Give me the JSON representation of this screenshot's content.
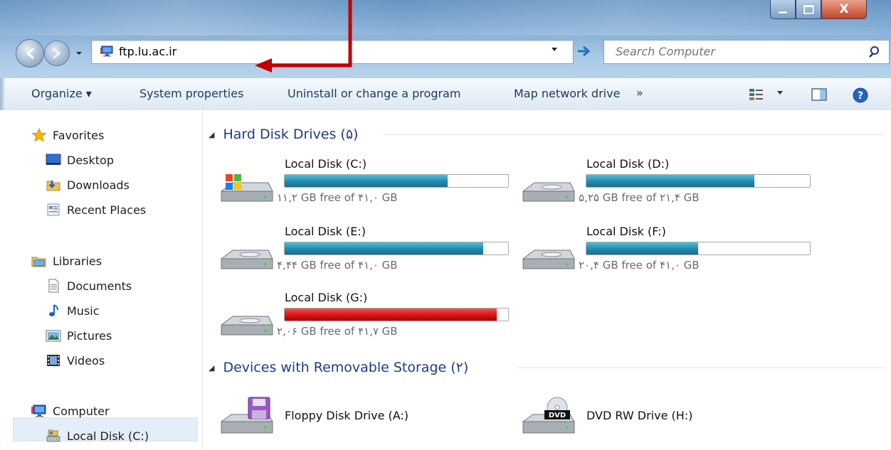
{
  "window": {
    "address": "ftp.lu.ac.ir",
    "search_placeholder": "Search Computer",
    "close_glyph": "X"
  },
  "toolbar": {
    "organize": "Organize ▾",
    "system_properties": "System properties",
    "uninstall": "Uninstall or change a program",
    "map_network_drive": "Map network drive",
    "more": "»"
  },
  "sidebar": {
    "favorites": {
      "label": "Favorites",
      "items": [
        "Desktop",
        "Downloads",
        "Recent Places"
      ]
    },
    "libraries": {
      "label": "Libraries",
      "items": [
        "Documents",
        "Music",
        "Pictures",
        "Videos"
      ]
    },
    "computer": {
      "label": "Computer",
      "items": [
        "Local Disk (C:)"
      ]
    }
  },
  "main": {
    "hard_disk_header": "Hard Disk Drives (۵)",
    "drives": [
      {
        "name": "Local Disk (C:)",
        "free_text": "۱۱,۲ GB free of ۴۱,۰ GB",
        "used_fraction": 0.73,
        "color": "#2389ae"
      },
      {
        "name": "Local Disk (D:)",
        "free_text": "۵,۲۵ GB free of ۲۱,۴ GB",
        "used_fraction": 0.75,
        "color": "#2389ae"
      },
      {
        "name": "Local Disk (E:)",
        "free_text": "۴,۴۴ GB free of ۴۱,۰ GB",
        "used_fraction": 0.89,
        "color": "#2389ae"
      },
      {
        "name": "Local Disk (F:)",
        "free_text": "۲۰,۴ GB free of ۴۱,۰ GB",
        "used_fraction": 0.5,
        "color": "#2389ae"
      },
      {
        "name": "Local Disk (G:)",
        "free_text": "۲,۰۶ GB free of ۴۱,۷ GB",
        "used_fraction": 0.95,
        "color": "#d81212"
      }
    ],
    "removable_header": "Devices with Removable Storage (۲)",
    "devices": [
      {
        "name": "Floppy Disk Drive (A:)"
      },
      {
        "name": "DVD RW Drive (H:)",
        "icon_label": "DVD"
      }
    ]
  },
  "colors": {
    "accent": "#1e3a8a",
    "annotation": "#c00000"
  }
}
